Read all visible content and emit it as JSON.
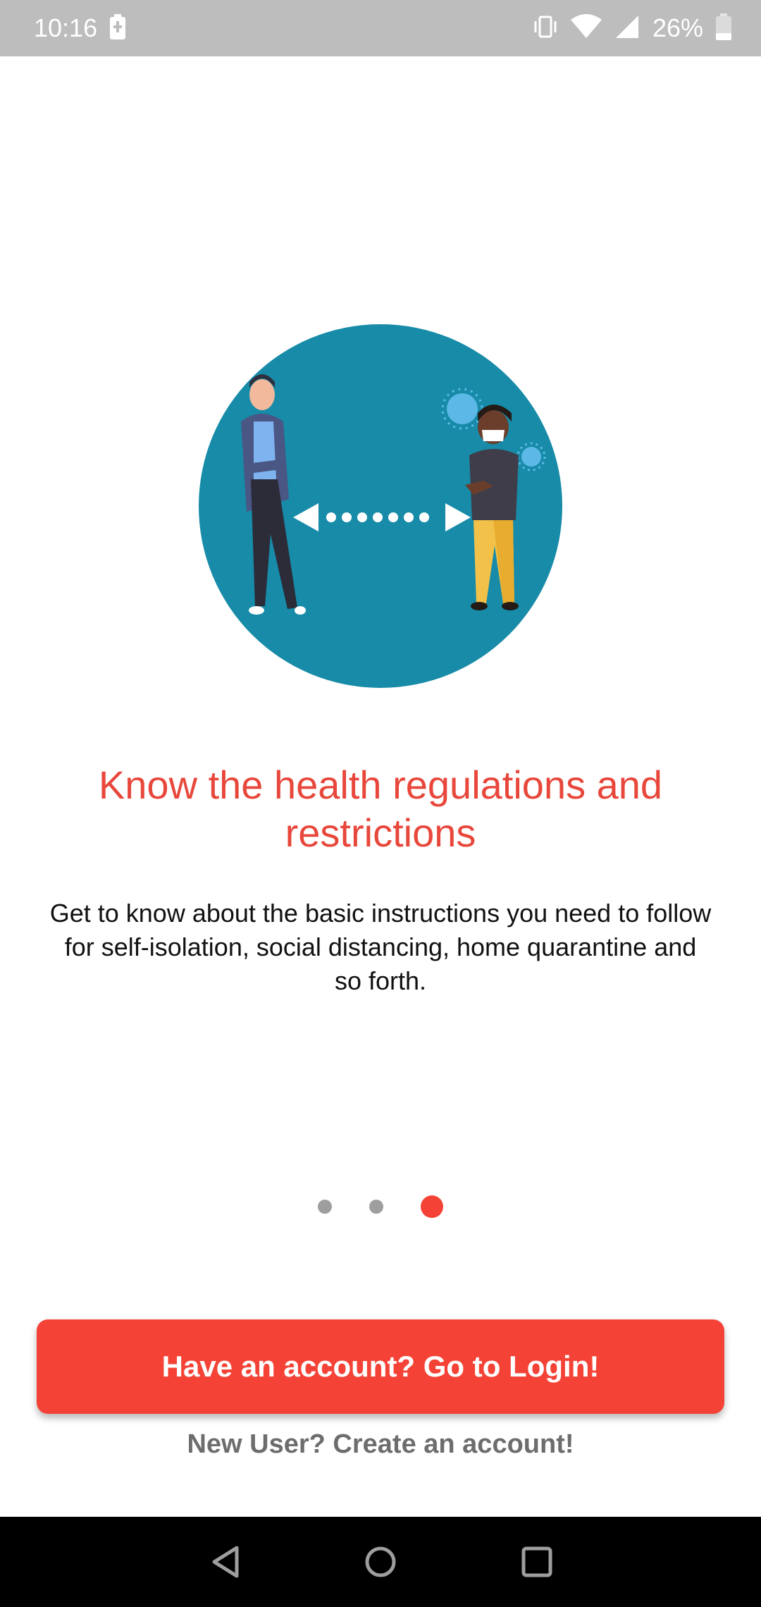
{
  "status_bar": {
    "time": "10:16",
    "battery_percent": "26%"
  },
  "onboarding": {
    "illustration_icon": "social-distancing-illustration",
    "headline": "Know the health regulations and restrictions",
    "body": "Get to know about the basic instructions you need to follow for self-isolation, social distancing, home quarantine and so forth.",
    "page_indicator": {
      "total": 3,
      "current": 3
    }
  },
  "actions": {
    "login_label": "Have an account? Go to Login!",
    "create_account_label": "New User? Create an account!"
  },
  "colors": {
    "accent": "#f44336",
    "headline": "#e8473b",
    "illustration_bg": "#178ba8"
  }
}
